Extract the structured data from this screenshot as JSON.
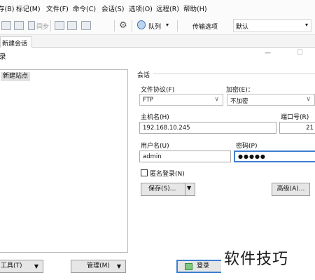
{
  "menu": {
    "items": [
      "存(B)",
      "标记(M)",
      "文件(F)",
      "命令(C)",
      "会话(S)",
      "选项(O)",
      "远程(R)",
      "帮助(H)"
    ]
  },
  "toolbar": {
    "sync_label": "同步",
    "queue_label": "队列",
    "transfer_options_label": "传输选项",
    "transfer_options_value": "默认",
    "dropdown_arrow": "▾"
  },
  "tabs": {
    "new_session": "新建会话"
  },
  "dialog": {
    "title": "录",
    "minimize_glyph": "—",
    "maximize_glyph": "☐"
  },
  "site_tree": {
    "items": [
      "新建站点"
    ]
  },
  "session": {
    "group_label": "会话",
    "protocol_label": "文件协议(F)",
    "protocol_value": "FTP",
    "encryption_label": "加密(E)：",
    "encryption_value": "不加密",
    "host_label": "主机名(H)",
    "host_value": "192.168.10.245",
    "port_label": "端口号(R)",
    "port_value": "21",
    "username_label": "用户名(U)",
    "username_value": "admin",
    "password_label": "密码(P)",
    "password_value": "●●●●●",
    "anonymous_label": "匿名登录(N)",
    "anonymous_checked": false,
    "save_label": "保存(S)...",
    "save_arrow": "▼",
    "advanced_label": "高级(A)...",
    "combo_arrow": "∨"
  },
  "footer": {
    "tools_label": "工具(T)",
    "manage_label": "管理(M)",
    "login_label": "登录",
    "dropdown_arrow": "▼"
  },
  "watermark": {
    "text": "软件技巧"
  },
  "colors": {
    "accent_green": "#2e8b3a",
    "focus_border": "#3c7fd1"
  }
}
